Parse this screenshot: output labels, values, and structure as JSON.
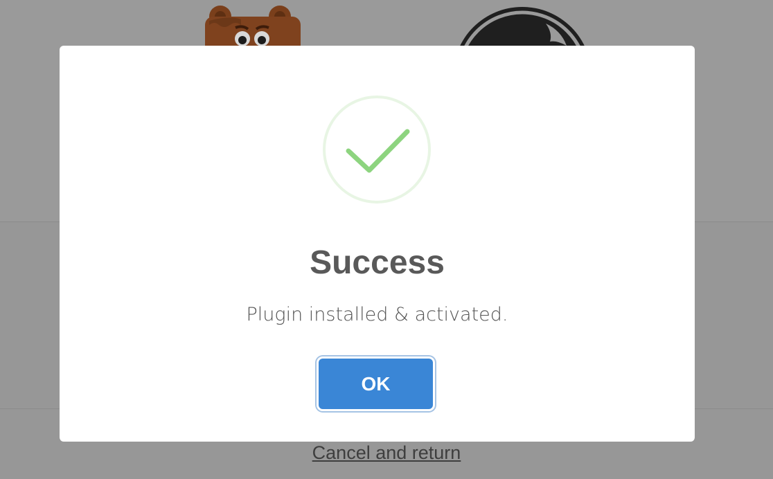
{
  "background": {
    "logos": [
      "bear-mascot-logo",
      "circle-logo"
    ]
  },
  "dialog": {
    "icon": "checkmark-icon",
    "title": "Success",
    "message": "Plugin installed & activated.",
    "ok_label": "OK"
  },
  "footer": {
    "cancel_link": "Cancel and return"
  },
  "colors": {
    "accent": "#3a86d6",
    "success": "#8dd47f",
    "overlay": "#979797"
  }
}
